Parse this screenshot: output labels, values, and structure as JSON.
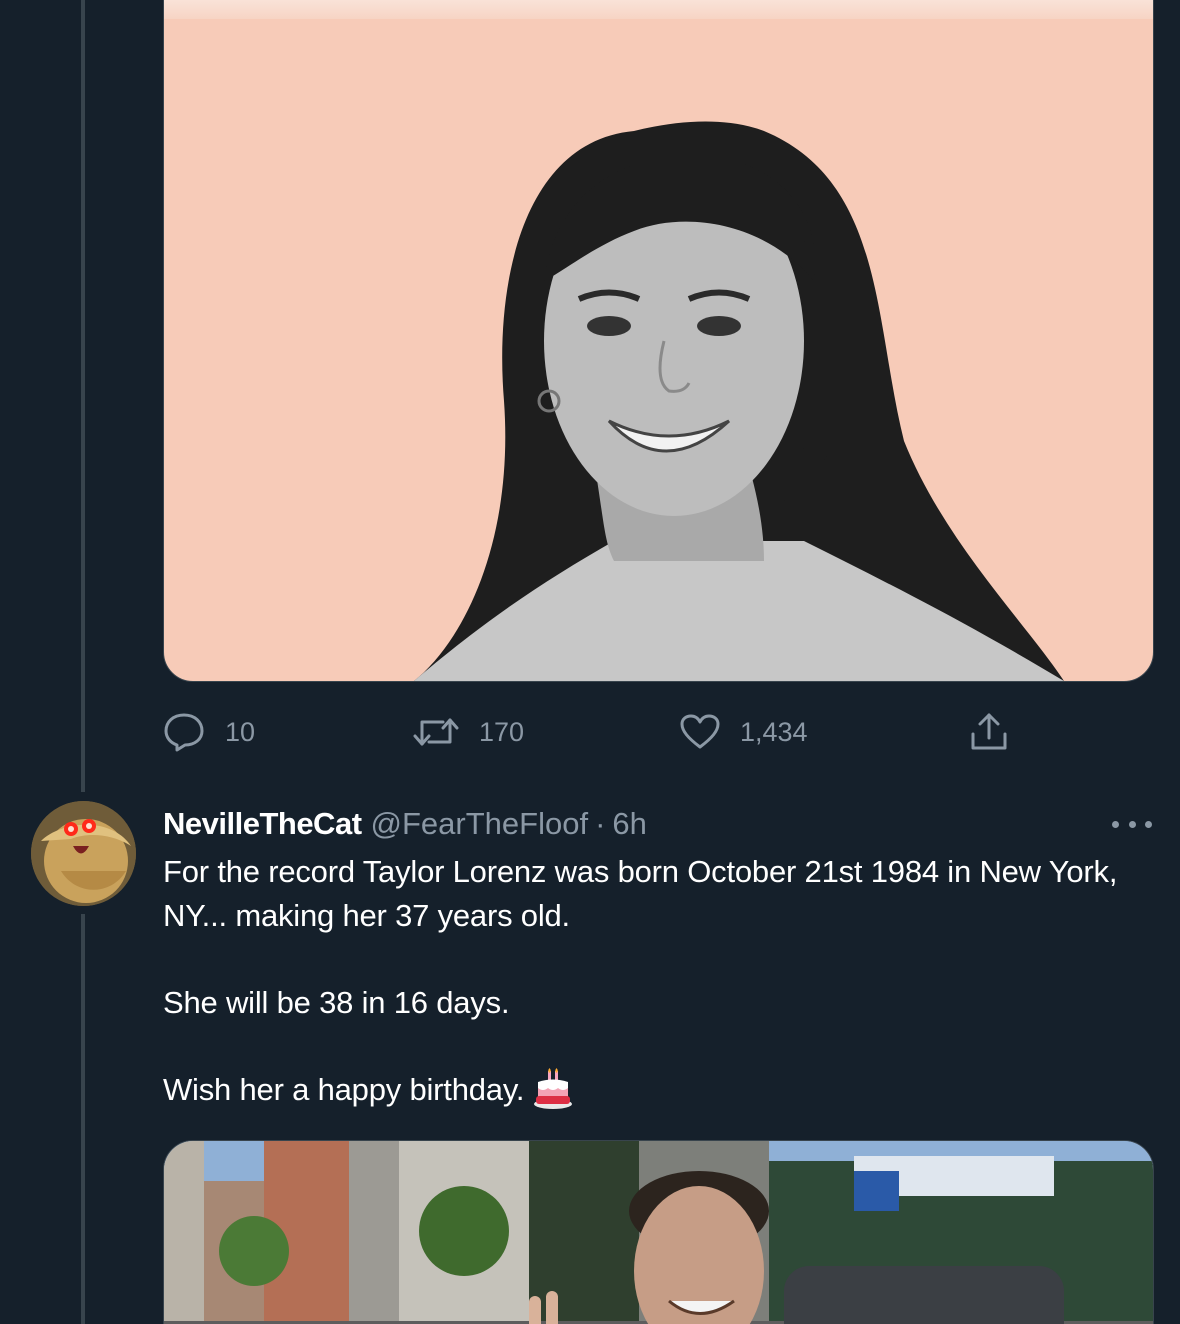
{
  "colors": {
    "background": "#15202b",
    "thread_line": "#38444d",
    "muted_text": "#8b98a5",
    "primary_text": "#ffffff",
    "image_background": "#f7cbb8"
  },
  "first_tweet": {
    "media": {
      "icon": "photo-portrait"
    },
    "actions": {
      "reply": {
        "icon": "reply-icon",
        "count": "10"
      },
      "retweet": {
        "icon": "retweet-icon",
        "count": "170"
      },
      "like": {
        "icon": "heart-icon",
        "count": "1,434"
      },
      "share": {
        "icon": "share-icon"
      }
    }
  },
  "second_tweet": {
    "author": {
      "display_name": "NevilleTheCat",
      "handle": "@FearTheFloof",
      "separator": "·",
      "time": "6h"
    },
    "text": {
      "line1": "For the record Taylor Lorenz was born October 21st 1984 in New York, NY... making her 37 years old.",
      "line2": "She will be 38 in 16 days.",
      "line3": "Wish her a happy birthday."
    },
    "emoji": "birthday-cake",
    "media": {
      "icon": "photo-street"
    }
  }
}
